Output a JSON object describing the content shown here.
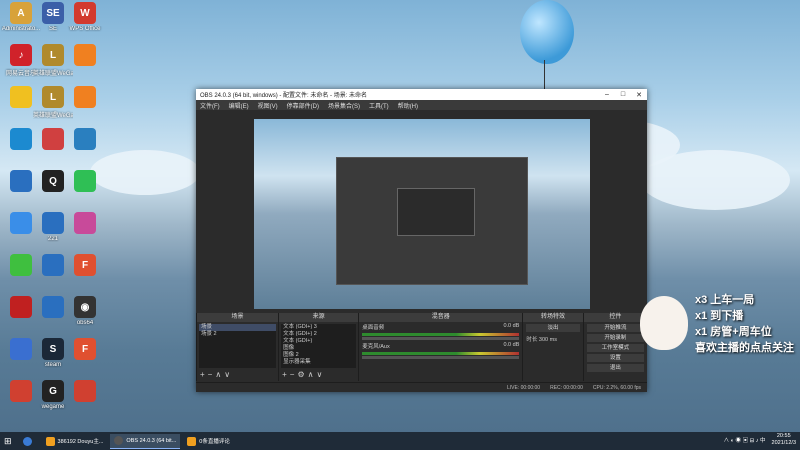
{
  "desktop": {
    "icons": [
      {
        "label": "Administrato...",
        "color": "#d8a23a",
        "glyph": "A"
      },
      {
        "label": "SE",
        "color": "#3b5fa8",
        "glyph": "SE"
      },
      {
        "label": "WPS Office",
        "color": "#d23a2e",
        "glyph": "W"
      },
      {
        "label": "网易云音乐",
        "color": "#d0222a",
        "glyph": "♪"
      },
      {
        "label": "英雄联盟WeGame版",
        "color": "#b08a2c",
        "glyph": "L"
      },
      {
        "label": "",
        "color": "#f08020",
        "glyph": ""
      },
      {
        "label": "",
        "color": "#f0c020",
        "glyph": ""
      },
      {
        "label": "英雄联盟WeGame版",
        "color": "#b08a2c",
        "glyph": "L"
      },
      {
        "label": "",
        "color": "#f08020",
        "glyph": ""
      },
      {
        "label": "",
        "color": "#1c8ad0",
        "glyph": ""
      },
      {
        "label": "",
        "color": "#d04040",
        "glyph": ""
      },
      {
        "label": "",
        "color": "#2a7fbf",
        "glyph": ""
      },
      {
        "label": "",
        "color": "#2a6fbf",
        "glyph": ""
      },
      {
        "label": "",
        "color": "#222",
        "glyph": "Q"
      },
      {
        "label": "",
        "color": "#2fbf55",
        "glyph": ""
      },
      {
        "label": "",
        "color": "#3a8ee8",
        "glyph": ""
      },
      {
        "label": "221",
        "color": "#2a6fbf",
        "glyph": ""
      },
      {
        "label": "",
        "color": "#c84a9a",
        "glyph": ""
      },
      {
        "label": "",
        "color": "#3fbf3f",
        "glyph": ""
      },
      {
        "label": "",
        "color": "#2a6fbf",
        "glyph": ""
      },
      {
        "label": "",
        "color": "#e05030",
        "glyph": "F"
      },
      {
        "label": "",
        "color": "#c02020",
        "glyph": ""
      },
      {
        "label": "",
        "color": "#2a6fbf",
        "glyph": ""
      },
      {
        "label": "obs64",
        "color": "#333",
        "glyph": "◉"
      },
      {
        "label": "",
        "color": "#3a6fd0",
        "glyph": ""
      },
      {
        "label": "steam",
        "color": "#1b2838",
        "glyph": "S"
      },
      {
        "label": "",
        "color": "#e05030",
        "glyph": "F"
      },
      {
        "label": "",
        "color": "#d04030",
        "glyph": ""
      },
      {
        "label": "wegame",
        "color": "#222",
        "glyph": "G"
      },
      {
        "label": "",
        "color": "#d04030",
        "glyph": ""
      }
    ]
  },
  "obs": {
    "title": "OBS 24.0.3 (64 bit, windows) - 配置文件: 未命名 - 场景: 未命名",
    "menu": [
      "文件(F)",
      "编辑(E)",
      "视图(V)",
      "停靠部件(D)",
      "场景集合(S)",
      "工具(T)",
      "帮助(H)"
    ],
    "docks": {
      "scenes": {
        "title": "场景",
        "items": [
          "场景",
          "场景 2"
        ]
      },
      "sources": {
        "title": "来源",
        "items": [
          "文本 (GDI+) 3",
          "文本 (GDI+) 2",
          "文本 (GDI+)",
          "图像",
          "图像 2",
          "显示器采集"
        ]
      },
      "mixer": {
        "title": "混音器",
        "tracks": [
          {
            "name": "桌面音频",
            "value": "0.0 dB"
          },
          {
            "name": "麦克风/Aux",
            "value": "0.0 dB"
          }
        ]
      },
      "transitions": {
        "title": "转场特效",
        "type": "淡出",
        "duration_label": "时长",
        "duration": "300 ms"
      },
      "controls": {
        "title": "控件",
        "buttons": [
          "开始推流",
          "开始录制",
          "工作室模式",
          "设置",
          "退出"
        ]
      }
    },
    "status": {
      "live": "LIVE: 00:00:00",
      "rec": "REC: 00:00:00",
      "cpu": "CPU: 2.2%, 60.00 fps"
    }
  },
  "overlay": {
    "lines": [
      "x3 上车一局",
      "x1 到下播",
      "x1 房管+周车位",
      "喜欢主播的点点关注"
    ]
  },
  "taskbar": {
    "items": [
      {
        "label": "386192 Douyu主...",
        "color": "#f0a020"
      },
      {
        "label": "OBS 24.0.3 (64 bit...",
        "color": "#333"
      },
      {
        "label": "0条直播评论",
        "color": "#f0a020"
      }
    ],
    "time": "20:55",
    "date": "2021/12/3"
  }
}
